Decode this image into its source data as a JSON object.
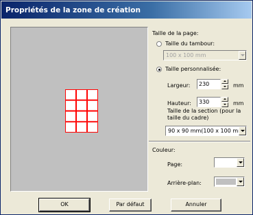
{
  "window": {
    "title": "Propriétés de la zone de création"
  },
  "page_size": {
    "section_label": "Taille de la page:",
    "hoop_option_label": "Taille du tambour:",
    "hoop_option_selected": false,
    "hoop_size_value": "100 x 100 mm",
    "custom_option_label": "Taille personnalisée:",
    "custom_option_selected": true,
    "width_label": "Largeur:",
    "width_value": "230",
    "width_unit": "mm",
    "height_label": "Hauteur:",
    "height_value": "330",
    "height_unit": "mm",
    "section_size_label_line1": "Taille de la section (pour la",
    "section_size_label_line2": "taille du cadre)",
    "section_size_value": "90 x  90 mm(100 x 100 mm"
  },
  "color": {
    "section_label": "Couleur:",
    "page_label": "Page:",
    "page_color": "#ffffff",
    "background_label": "Arrière-plan:",
    "background_color": "#c0c0c0"
  },
  "preview": {
    "background_color": "#c0c0c0",
    "grid": {
      "columns": 3,
      "rows": 4,
      "line_color": "#ff0000",
      "fill_color": "#ffffff"
    }
  },
  "buttons": {
    "ok": "OK",
    "default": "Par défaut",
    "cancel": "Annuler"
  }
}
